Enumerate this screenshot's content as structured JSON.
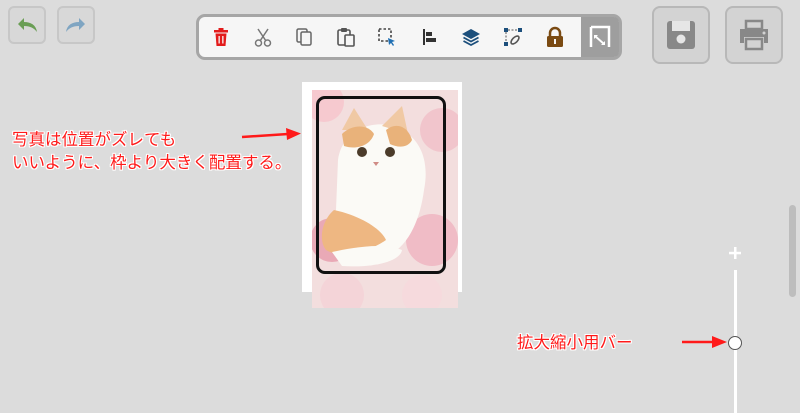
{
  "header": {
    "undo_icon": "undo-icon",
    "redo_icon": "redo-icon",
    "save_icon": "save-icon",
    "print_icon": "print-icon"
  },
  "toolbar": {
    "tools": [
      "trash-icon",
      "scissors-icon",
      "copy-icon",
      "paste-icon",
      "select-area-icon",
      "align-left-icon",
      "layers-icon",
      "link-points-icon",
      "lock-icon",
      "rotate-corner-icon"
    ],
    "active_tool": "rotate-corner-icon",
    "delete_color": "#e31b1b",
    "lock_color": "#7a4a12"
  },
  "annotations": {
    "photo_note_line1": "写真は位置がズレても",
    "photo_note_line2": "いいように、枠より大きく配置する。",
    "zoom_note": "拡大縮小用バー"
  },
  "zoom": {
    "plus_label": "+",
    "level": 0.45
  },
  "colors": {
    "annotation": "#ff1a1a",
    "background": "#dcdcdc"
  }
}
